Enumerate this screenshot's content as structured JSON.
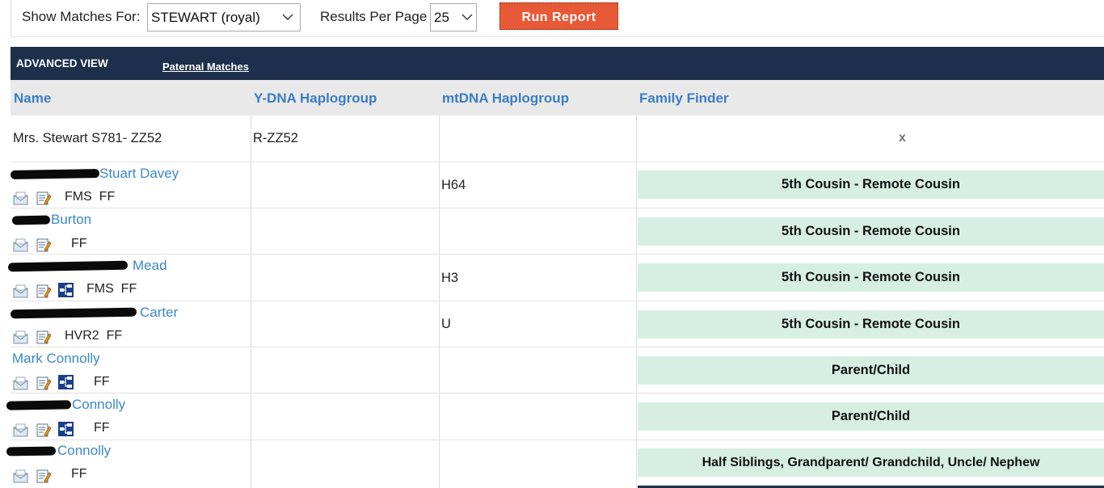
{
  "toolbar": {
    "show_matches_label": "Show Matches For:",
    "show_matches_value": "STEWART (royal)",
    "results_per_page_label": "Results Per Page",
    "results_per_page_value": "25",
    "run_report_label": "Run Report"
  },
  "view": {
    "title": "ADVANCED VIEW",
    "paternal_link": "Paternal Matches"
  },
  "columns": {
    "name": "Name",
    "ydna": "Y-DNA Haplogroup",
    "mtdna": "mtDNA Haplogroup",
    "family_finder": "Family Finder"
  },
  "self_row": {
    "name": "Mrs. Stewart S781- ZZ52",
    "ydna": "R-ZZ52",
    "mtdna": "",
    "family_finder": "x"
  },
  "matches": [
    {
      "name": "Stuart Davey",
      "tags": "FMS  FF",
      "ydna": "",
      "mtdna": "H64",
      "relationship": "5th Cousin - Remote Cousin"
    },
    {
      "name": "Burton",
      "tags": "FF",
      "ydna": "",
      "mtdna": "",
      "relationship": "5th Cousin - Remote Cousin"
    },
    {
      "name": "Mead",
      "tags": "FMS  FF",
      "ydna": "",
      "mtdna": "H3",
      "relationship": "5th Cousin - Remote Cousin"
    },
    {
      "name": "Carter",
      "tags": "HVR2  FF",
      "ydna": "",
      "mtdna": "U",
      "relationship": "5th Cousin - Remote Cousin"
    },
    {
      "name": "Mark Connolly",
      "tags": "FF",
      "ydna": "",
      "mtdna": "",
      "relationship": "Parent/Child"
    },
    {
      "name": "Connolly",
      "tags": "FF",
      "ydna": "",
      "mtdna": "",
      "relationship": "Parent/Child"
    },
    {
      "name": "Connolly",
      "tags": "FF",
      "ydna": "",
      "mtdna": "",
      "relationship": "Half Siblings, Grandparent/ Grandchild, Uncle/ Nephew"
    }
  ],
  "icons": [
    "mail-icon",
    "notes-icon",
    "tree-icon"
  ],
  "colors": {
    "header_bar": "#1d2f4a",
    "link_blue": "#3b88c6",
    "run_button": "#e75a37",
    "relationship_bg": "#d6efe2"
  }
}
